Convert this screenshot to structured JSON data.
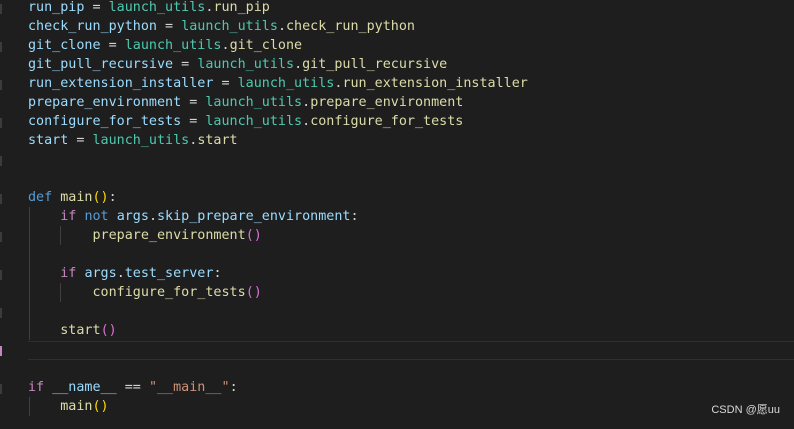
{
  "code": {
    "run_pip": {
      "name": "run_pip",
      "eq": " = ",
      "mod": "launch_utils",
      "dot": ".",
      "attr": "run_pip"
    },
    "check_run_python": {
      "name": "check_run_python",
      "eq": " = ",
      "mod": "launch_utils",
      "dot": ".",
      "attr": "check_run_python"
    },
    "git_clone": {
      "name": "git_clone",
      "eq": " = ",
      "mod": "launch_utils",
      "dot": ".",
      "attr": "git_clone"
    },
    "git_pull_recursive": {
      "name": "git_pull_recursive",
      "eq": " = ",
      "mod": "launch_utils",
      "dot": ".",
      "attr": "git_pull_recursive"
    },
    "run_extension_installer": {
      "name": "run_extension_installer",
      "eq": " = ",
      "mod": "launch_utils",
      "dot": ".",
      "attr": "run_extension_installer"
    },
    "prepare_environment": {
      "name": "prepare_environment",
      "eq": " = ",
      "mod": "launch_utils",
      "dot": ".",
      "attr": "prepare_environment"
    },
    "configure_for_tests": {
      "name": "configure_for_tests",
      "eq": " = ",
      "mod": "launch_utils",
      "dot": ".",
      "attr": "configure_for_tests"
    },
    "start": {
      "name": "start",
      "eq": " = ",
      "mod": "launch_utils",
      "dot": ".",
      "attr": "start"
    },
    "def_line": {
      "kw": "def",
      "fn": "main",
      "parens": "()",
      "colon": ":"
    },
    "if1": {
      "kw": "if",
      "not": "not",
      "obj": "args",
      "dot": ".",
      "attr": "skip_prepare_environment",
      "colon": ":"
    },
    "call1": {
      "fn": "prepare_environment",
      "parens": "()"
    },
    "if2": {
      "kw": "if",
      "obj": "args",
      "dot": ".",
      "attr": "test_server",
      "colon": ":"
    },
    "call2": {
      "fn": "configure_for_tests",
      "parens": "()"
    },
    "call3": {
      "fn": "start",
      "parens": "()"
    },
    "if_main": {
      "kw": "if",
      "name": "__name__",
      "eq": " == ",
      "str": "\"__main__\"",
      "colon": ":"
    },
    "call_main": {
      "fn": "main",
      "parens": "()"
    }
  },
  "watermark": "CSDN @愿uu",
  "colors": {
    "background": "#1e1e1e",
    "keyword": "#569cd6",
    "control_keyword": "#c586c0",
    "function": "#dcdcaa",
    "module": "#4ec9b0",
    "variable": "#9cdcfe",
    "string": "#ce9178",
    "bracket": "#ffd700"
  }
}
